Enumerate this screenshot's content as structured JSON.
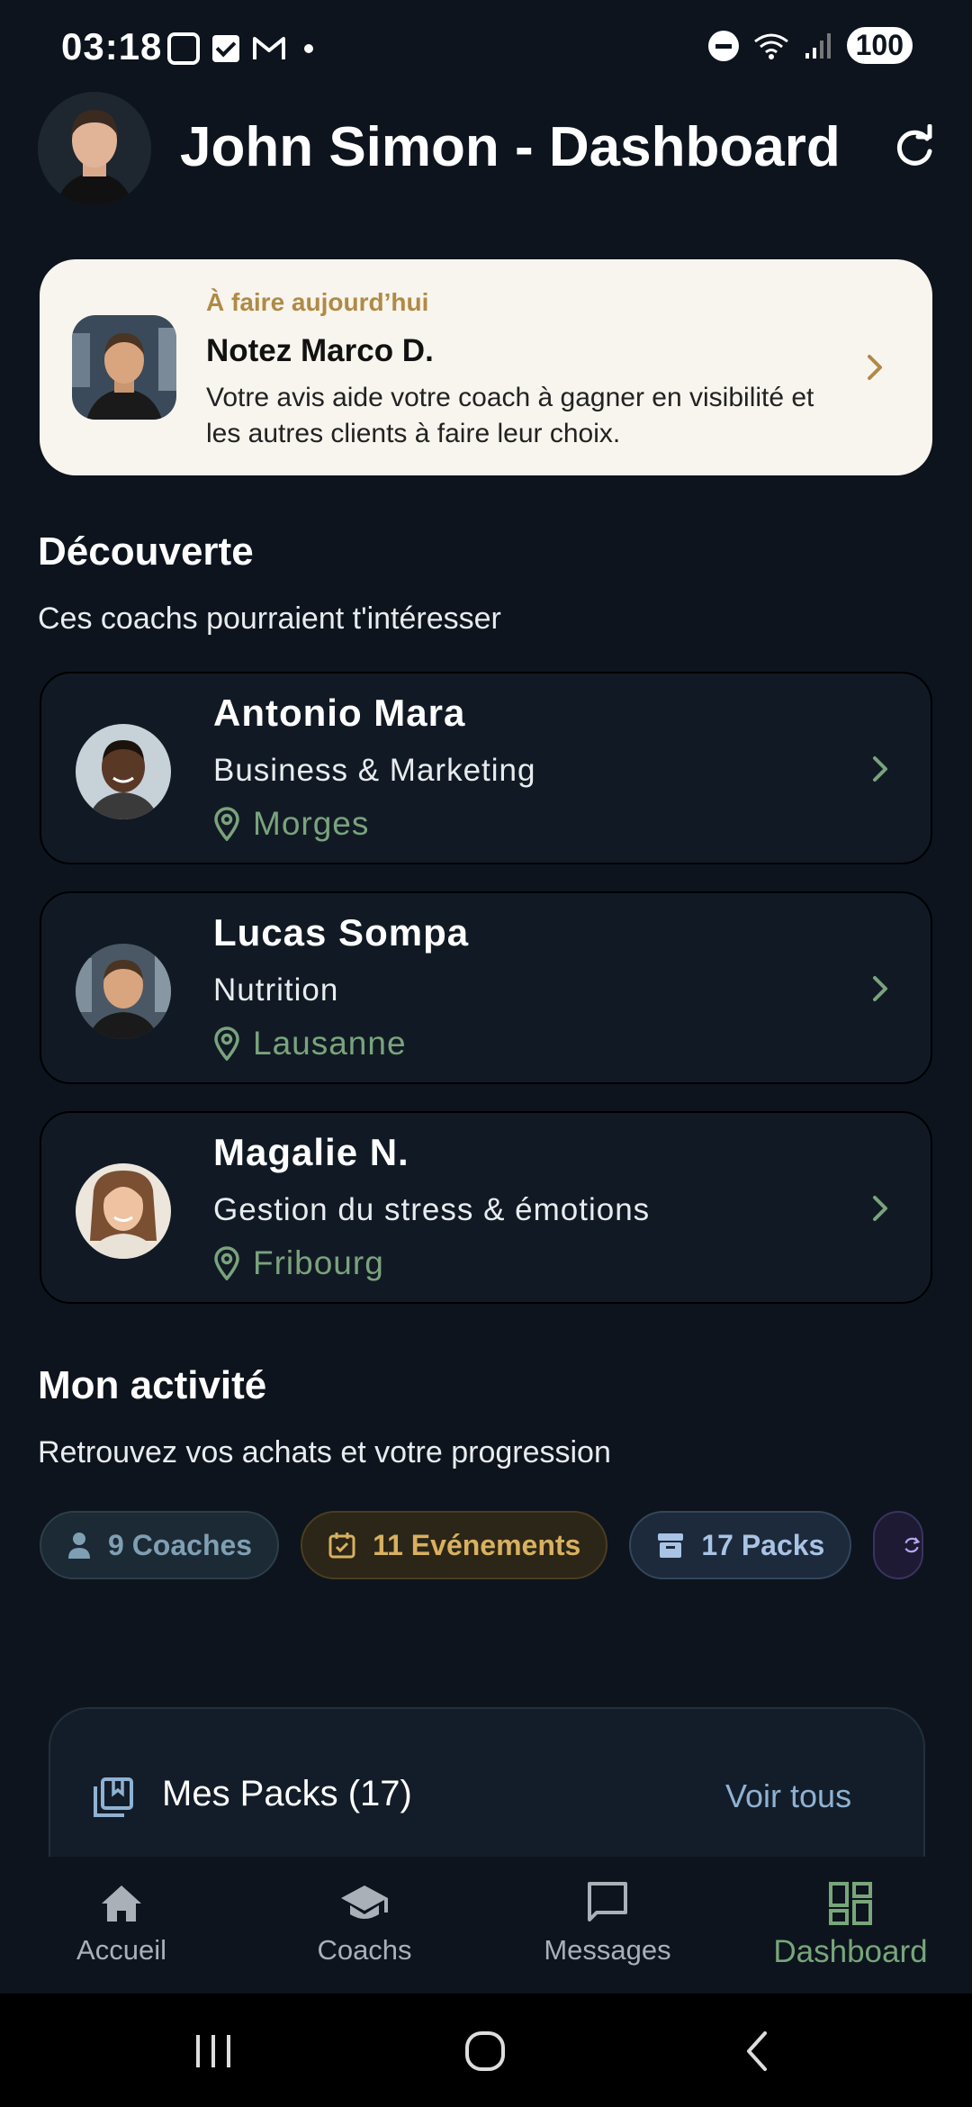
{
  "status": {
    "time": "03:18",
    "battery": "100"
  },
  "header": {
    "title": "John Simon - Dashboard"
  },
  "todo": {
    "kicker": "À faire aujourd’hui",
    "title": "Notez Marco D.",
    "text": "Votre avis aide votre coach à gagner en visibilité et les autres clients à faire leur choix."
  },
  "discover": {
    "title": "Découverte",
    "subtitle": "Ces coachs pourraient t'intéresser",
    "coaches": [
      {
        "name": "Antonio Mara",
        "specialty": "Business & Marketing",
        "location": "Morges"
      },
      {
        "name": "Lucas Sompa",
        "specialty": "Nutrition",
        "location": "Lausanne"
      },
      {
        "name": "Magalie N.",
        "specialty": "Gestion du stress & émotions",
        "location": "Fribourg"
      }
    ]
  },
  "activity": {
    "title": "Mon activité",
    "subtitle": "Retrouvez vos achats et votre progression",
    "chips": [
      {
        "label": "9 Coaches",
        "icon": "person-icon"
      },
      {
        "label": "11 Evénements",
        "icon": "calendar-icon"
      },
      {
        "label": "17 Packs",
        "icon": "archive-icon"
      },
      {
        "label": "",
        "icon": "sync-icon"
      }
    ]
  },
  "packs": {
    "title": "Mes Packs (17)",
    "link": "Voir tous"
  },
  "nav": {
    "items": [
      {
        "label": "Accueil",
        "icon": "home-icon"
      },
      {
        "label": "Coachs",
        "icon": "graduation-cap-icon"
      },
      {
        "label": "Messages",
        "icon": "message-icon"
      },
      {
        "label": "Dashboard",
        "icon": "dashboard-icon"
      }
    ],
    "active": "Dashboard"
  },
  "colors": {
    "background": "#0d141d",
    "card": "#111a24",
    "accent_green": "#78a67a",
    "gold": "#b08a45"
  }
}
